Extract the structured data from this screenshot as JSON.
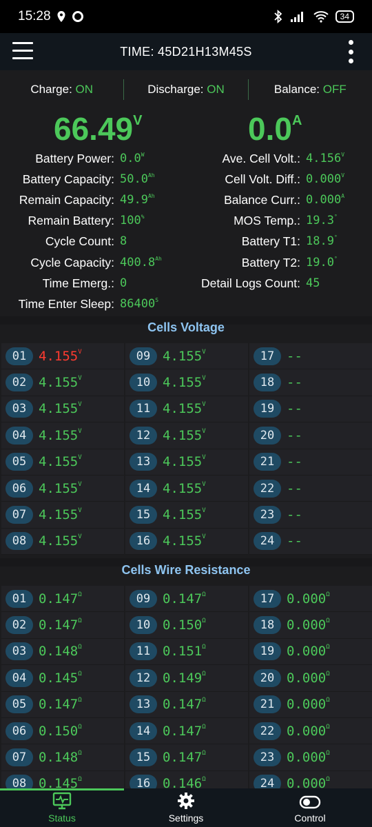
{
  "status_bar": {
    "time": "15:28",
    "battery": "34"
  },
  "app_bar": {
    "title": "TIME: 45D21H13M45S"
  },
  "switches": [
    {
      "label": "Charge: ",
      "state": "ON"
    },
    {
      "label": "Discharge: ",
      "state": "ON"
    },
    {
      "label": "Balance: ",
      "state": "OFF"
    }
  ],
  "main": {
    "voltage": "66.49",
    "voltage_unit": "V",
    "current": "0.0",
    "current_unit": "A"
  },
  "info_left": [
    {
      "label": "Battery Power:",
      "value": "0.0",
      "unit": "W"
    },
    {
      "label": "Battery Capacity:",
      "value": "50.0",
      "unit": "Ah"
    },
    {
      "label": "Remain Capacity:",
      "value": "49.9",
      "unit": "Ah"
    },
    {
      "label": "Remain Battery:",
      "value": "100",
      "unit": "%"
    },
    {
      "label": "Cycle Count:",
      "value": "8",
      "unit": ""
    },
    {
      "label": "Cycle Capacity:",
      "value": "400.8",
      "unit": "Ah"
    },
    {
      "label": "Time Emerg.:",
      "value": "0",
      "unit": ""
    },
    {
      "label": "Time Enter Sleep:",
      "value": "86400",
      "unit": "S"
    }
  ],
  "info_right": [
    {
      "label": "Ave. Cell Volt.:",
      "value": "4.156",
      "unit": "V"
    },
    {
      "label": "Cell Volt. Diff.:",
      "value": "0.000",
      "unit": "V"
    },
    {
      "label": "Balance Curr.:",
      "value": "0.000",
      "unit": "A"
    },
    {
      "label": "MOS Temp.:",
      "value": "19.3",
      "unit": "°"
    },
    {
      "label": "Battery T1:",
      "value": "18.9",
      "unit": "°"
    },
    {
      "label": "Battery T2:",
      "value": "19.0",
      "unit": "°"
    },
    {
      "label": "Detail Logs Count:",
      "value": "45",
      "unit": ""
    }
  ],
  "cells_voltage": {
    "title": "Cells Voltage",
    "unit": "V",
    "cells": [
      {
        "n": "01",
        "v": "4.155"
      },
      {
        "n": "02",
        "v": "4.155"
      },
      {
        "n": "03",
        "v": "4.155"
      },
      {
        "n": "04",
        "v": "4.155"
      },
      {
        "n": "05",
        "v": "4.155"
      },
      {
        "n": "06",
        "v": "4.155"
      },
      {
        "n": "07",
        "v": "4.155"
      },
      {
        "n": "08",
        "v": "4.155"
      },
      {
        "n": "09",
        "v": "4.155"
      },
      {
        "n": "10",
        "v": "4.155"
      },
      {
        "n": "11",
        "v": "4.155"
      },
      {
        "n": "12",
        "v": "4.155"
      },
      {
        "n": "13",
        "v": "4.155"
      },
      {
        "n": "14",
        "v": "4.155"
      },
      {
        "n": "15",
        "v": "4.155"
      },
      {
        "n": "16",
        "v": "4.155"
      },
      {
        "n": "17",
        "v": "--"
      },
      {
        "n": "18",
        "v": "--"
      },
      {
        "n": "19",
        "v": "--"
      },
      {
        "n": "20",
        "v": "--"
      },
      {
        "n": "21",
        "v": "--"
      },
      {
        "n": "22",
        "v": "--"
      },
      {
        "n": "23",
        "v": "--"
      },
      {
        "n": "24",
        "v": "--"
      }
    ],
    "highlight_color": "#ff3b30"
  },
  "cells_resistance": {
    "title": "Cells Wire Resistance",
    "unit": "Ω",
    "cells": [
      {
        "n": "01",
        "v": "0.147"
      },
      {
        "n": "02",
        "v": "0.147"
      },
      {
        "n": "03",
        "v": "0.148"
      },
      {
        "n": "04",
        "v": "0.145"
      },
      {
        "n": "05",
        "v": "0.147"
      },
      {
        "n": "06",
        "v": "0.150"
      },
      {
        "n": "07",
        "v": "0.148"
      },
      {
        "n": "08",
        "v": "0.145"
      },
      {
        "n": "09",
        "v": "0.147"
      },
      {
        "n": "10",
        "v": "0.150"
      },
      {
        "n": "11",
        "v": "0.151"
      },
      {
        "n": "12",
        "v": "0.149"
      },
      {
        "n": "13",
        "v": "0.147"
      },
      {
        "n": "14",
        "v": "0.147"
      },
      {
        "n": "15",
        "v": "0.147"
      },
      {
        "n": "16",
        "v": "0.146"
      },
      {
        "n": "17",
        "v": "0.000"
      },
      {
        "n": "18",
        "v": "0.000"
      },
      {
        "n": "19",
        "v": "0.000"
      },
      {
        "n": "20",
        "v": "0.000"
      },
      {
        "n": "21",
        "v": "0.000"
      },
      {
        "n": "22",
        "v": "0.000"
      },
      {
        "n": "23",
        "v": "0.000"
      },
      {
        "n": "24",
        "v": "0.000"
      }
    ]
  },
  "bottom_nav": [
    {
      "label": "Status",
      "icon": "monitor-icon",
      "active": true
    },
    {
      "label": "Settings",
      "icon": "gear-icon",
      "active": false
    },
    {
      "label": "Control",
      "icon": "toggle-icon",
      "active": false
    }
  ],
  "colors": {
    "accent": "#4cc85a",
    "section_title": "#8ec4f0",
    "index_pill": "#1f4a63"
  }
}
